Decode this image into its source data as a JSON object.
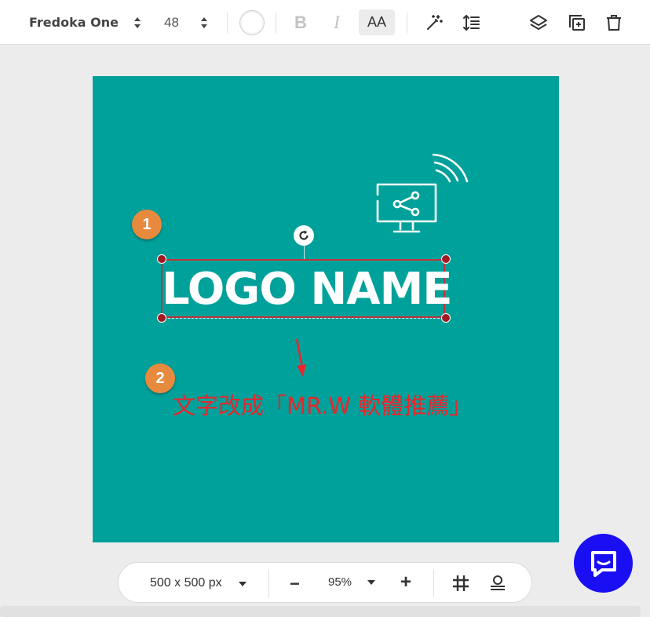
{
  "toolbar": {
    "font_family": "Fredoka One",
    "font_size": "48",
    "bold_label": "B",
    "italic_label": "I",
    "case_label": "AA",
    "icons": [
      "magic-wand-icon",
      "line-spacing-icon",
      "layers-icon",
      "duplicate-icon",
      "trash-icon"
    ]
  },
  "canvas": {
    "background_color": "#00a19a",
    "logo_text": "LOGO NAME",
    "selection_color": "#c0343c",
    "icon": "monitor-share-icon"
  },
  "annotations": {
    "badge_1": "1",
    "badge_2": "2",
    "instruction": "文字改成「MR.W 軟體推薦」",
    "color": "#e8262b"
  },
  "bottombar": {
    "canvas_size": "500 x 500 px",
    "zoom": "95%",
    "minus_label": "−",
    "plus_label": "+"
  },
  "chat": {
    "color": "#1a0ef2"
  }
}
